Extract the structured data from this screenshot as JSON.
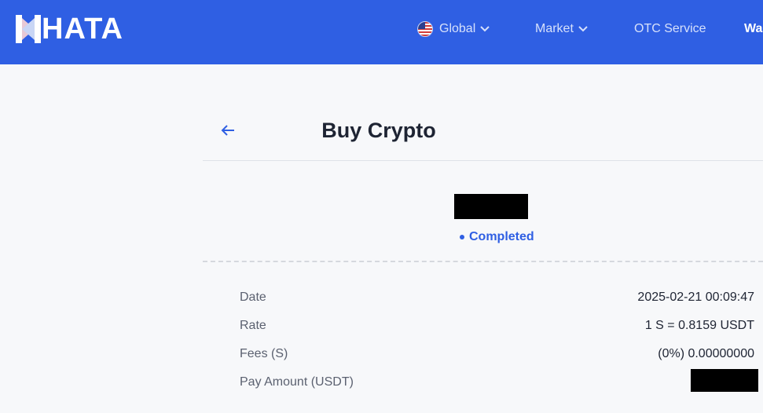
{
  "header": {
    "logo_text": "HATA",
    "nav": {
      "global_label": "Global",
      "market_label": "Market",
      "otc_label": "OTC Service",
      "wallet_label": "Wa"
    }
  },
  "page": {
    "title": "Buy Crypto",
    "status": "Completed",
    "details": [
      {
        "label": "Date",
        "value": "2025-02-21 00:09:47"
      },
      {
        "label": "Rate",
        "value": "1 S = 0.8159 USDT"
      },
      {
        "label": "Fees (S)",
        "value": "(0%) 0.00000000"
      },
      {
        "label": "Pay Amount (USDT)",
        "value": ""
      }
    ]
  },
  "colors": {
    "brand": "#2f5fe3",
    "status": "#2f5fe3"
  },
  "icons": {
    "globe": "us-flag-globe-icon",
    "back": "arrow-left-icon",
    "dropdown": "chevron-down-icon"
  }
}
